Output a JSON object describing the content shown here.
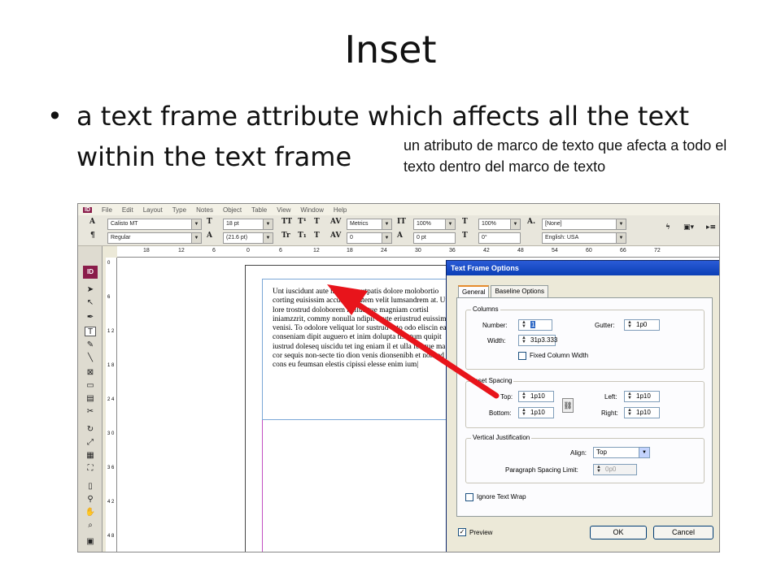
{
  "slide": {
    "title": "Inset",
    "bullet": "a text frame attribute which affects all the text\nwithin the text frame",
    "translation": "un atributo de marco de texto que afecta a todo el texto dentro del marco de texto"
  },
  "app": {
    "logo": "ID",
    "menu": [
      "File",
      "Edit",
      "Layout",
      "Type",
      "Notes",
      "Object",
      "Table",
      "View",
      "Window",
      "Help"
    ],
    "control_panel": {
      "font_family": "Calisto MT",
      "font_style": "Regular",
      "font_size": "18 pt",
      "leading": "(21.6 pt)",
      "kerning": "Metrics",
      "tracking": "0",
      "vertical_scale": "100%",
      "horizontal_scale": "100%",
      "baseline_shift": "0 pt",
      "skew": "0°",
      "char_style": "[None]",
      "language": "English: USA"
    },
    "ruler_top_ticks": [
      "18",
      "12",
      "6",
      "0",
      "6",
      "12",
      "18",
      "24",
      "30",
      "36",
      "42",
      "48",
      "54",
      "60",
      "66",
      "72"
    ],
    "ruler_left_ticks": [
      "0",
      "6",
      "1 2",
      "1 8",
      "2 4",
      "3 0",
      "3 6",
      "4 2",
      "4 8"
    ]
  },
  "document": {
    "body_text": "Unt iuscidunt aute modolut autpatis dolore molobortio corting euisissim accumsan utem velit lumsandrem at. Ut lore trostrud doloborem nullutetue magniam cortisl iniamzzrit, commy nonulla ndipit il ute eriustrud euissim venisi. To odolore veliquat lor sustrud esto odo eliscin ea conseniam dipit auguero et inim dolupta tis etum quipit iustrud doleseq uiscidu tet ing eniam il et ulla feugue magna cor sequis non-secte tio dion venis dionsenibh et nonsed tio cons eu feumsan elestis cipissi elesse enim ium|"
  },
  "dialog": {
    "title": "Text Frame Options",
    "tabs": [
      "General",
      "Baseline Options"
    ],
    "columns": {
      "group_label": "Columns",
      "number_label": "Number:",
      "number_value": "1",
      "gutter_label": "Gutter:",
      "gutter_value": "1p0",
      "width_label": "Width:",
      "width_value": "31p3.333",
      "fixed_width_label": "Fixed Column Width"
    },
    "inset": {
      "group_label": "Inset Spacing",
      "top_label": "Top:",
      "top_value": "1p10",
      "bottom_label": "Bottom:",
      "bottom_value": "1p10",
      "left_label": "Left:",
      "left_value": "1p10",
      "right_label": "Right:",
      "right_value": "1p10"
    },
    "vertical": {
      "group_label": "Vertical Justification",
      "align_label": "Align:",
      "align_value": "Top",
      "para_limit_label": "Paragraph Spacing Limit:",
      "para_limit_value": "0p0"
    },
    "ignore_wrap_label": "Ignore Text Wrap",
    "preview_label": "Preview",
    "ok_label": "OK",
    "cancel_label": "Cancel"
  }
}
